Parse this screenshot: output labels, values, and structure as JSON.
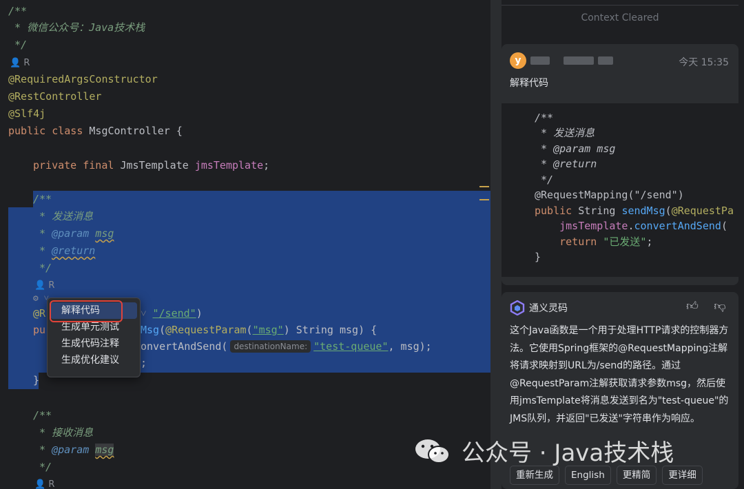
{
  "editor": {
    "comment_top": [
      "/**",
      " * 微信公众号：Java技术栈",
      " */"
    ],
    "author_label": "R",
    "annotations": [
      "@RequiredArgsConstructor",
      "@RestController",
      "@Slf4j"
    ],
    "class_decl": {
      "kw": "public class ",
      "name": "MsgController {"
    },
    "field_decl": {
      "kw": "private final ",
      "type": "JmsTemplate ",
      "name": "jmsTemplate",
      "end": ";"
    },
    "doc": {
      "open": "/**",
      "desc": " * 发送消息",
      "param_tag": "@param",
      "param_name": "msg",
      "return_tag": "@return",
      "close": " */",
      "star": " * "
    },
    "mapping": {
      "ann_prefix": "@R",
      "path": "\"/send\"",
      "close": ")"
    },
    "method_line": {
      "prefix": "pu",
      "fn_tail": "Msg",
      "open": "(",
      "req": "@RequestParam",
      "arg": "\"msg\"",
      "rest": ") String msg) {"
    },
    "send_line": {
      "call": "onvertAndSend(",
      "hint": "destinationName:",
      "queue": "\"test-queue\"",
      "rest": ", msg);"
    },
    "return_tail": ";",
    "close_brace": "}",
    "doc2": {
      "open": "/**",
      "desc": " * 接收消息",
      "param_tag": "@param",
      "param_name": "msg",
      "close": " */"
    },
    "author_label2": "R"
  },
  "context_menu": {
    "items": [
      "解释代码",
      "生成单元测试",
      "生成代码注释",
      "生成优化建议"
    ]
  },
  "panel": {
    "context_cleared": "Context Cleared",
    "user": {
      "avatar_letter": "y",
      "timestamp": "今天 15:35",
      "message": "解释代码"
    },
    "code": [
      "/**",
      " * 发送消息",
      " * @param msg",
      " * @return",
      " */",
      "@RequestMapping(\"/send\")",
      "public String sendMsg(@RequestPa",
      "    jmsTemplate.convertAndSend(",
      "    return \"已发送\";",
      "}"
    ],
    "bot": {
      "name": "通义灵码",
      "text": "这个Java函数是一个用于处理HTTP请求的控制器方法。它使用Spring框架的@RequestMapping注解将请求映射到URL为/send的路径。通过@RequestParam注解获取请求参数msg，然后使用jmsTemplate将消息发送到名为\"test-queue\"的JMS队列，并返回\"已发送\"字符串作为响应。",
      "actions": [
        "重新生成",
        "English",
        "更精简",
        "更详细"
      ]
    }
  },
  "watermark": {
    "text": "公众号 · Java技术栈"
  }
}
